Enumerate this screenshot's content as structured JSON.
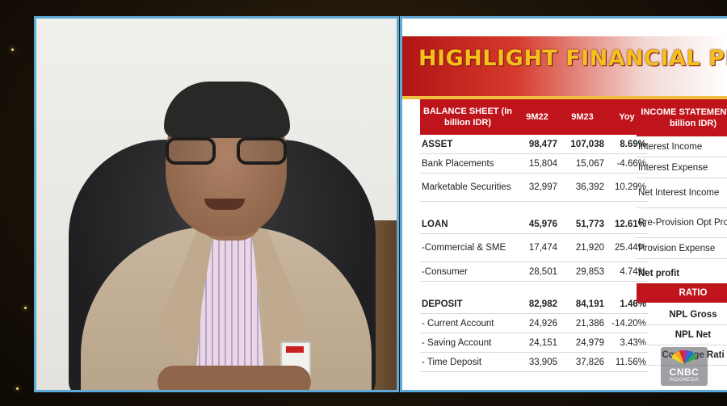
{
  "slide": {
    "title": "HIGHLIGHT FINANCIAL PE",
    "balance_sheet": {
      "headers": [
        "BALANCE SHEET (In billion IDR)",
        "9M22",
        "9M23",
        "Yoy"
      ],
      "rows": [
        {
          "label": "ASSET",
          "v1": "98,477",
          "v2": "107,038",
          "v3": "8.69%"
        },
        {
          "label": "Bank Placements",
          "v1": "15,804",
          "v2": "15,067",
          "v3": "-4.66%"
        },
        {
          "label": "Marketable Securities",
          "v1": "32,997",
          "v2": "36,392",
          "v3": "10.29%"
        },
        {
          "label": "LOAN",
          "v1": "45,976",
          "v2": "51,773",
          "v3": "12.61%"
        },
        {
          "label": "-Commercial & SME",
          "v1": "17,474",
          "v2": "21,920",
          "v3": "25.44%"
        },
        {
          "label": "-Consumer",
          "v1": "28,501",
          "v2": "29,853",
          "v3": "4.74%"
        },
        {
          "label": "DEPOSIT",
          "v1": "82,982",
          "v2": "84,191",
          "v3": "1.46%"
        },
        {
          "label": "-  Current Account",
          "v1": "24,926",
          "v2": "21,386",
          "v3": "-14.20%"
        },
        {
          "label": " - Saving Account",
          "v1": "24,151",
          "v2": "24,979",
          "v3": "3.43%"
        },
        {
          "label": "-  Time Deposit",
          "v1": "33,905",
          "v2": "37,826",
          "v3": "11.56%"
        }
      ]
    },
    "income_statement": {
      "header": "INCOME STATEMENT (In billion IDR)",
      "rows": [
        "Interest Income",
        "Interest Expense",
        "Net Interest Income",
        "Pre-Provision Opt Profit",
        "Provision Expense",
        "Net profit"
      ]
    },
    "ratio": {
      "header": "RATIO",
      "rows": [
        "NPL Gross",
        "NPL Net",
        "Coverage Rati"
      ]
    }
  },
  "logo": {
    "name": "CNBC",
    "sub": "INDONESIA"
  },
  "colors": {
    "accent_red": "#c0141c",
    "title_gold": "#f4c01d",
    "frame_blue": "#5fa9d6"
  }
}
